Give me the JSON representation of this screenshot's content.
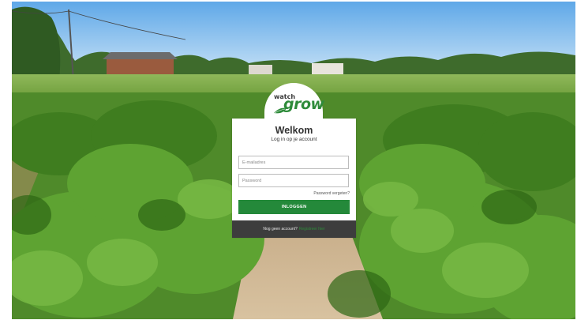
{
  "brand": {
    "logo_text_top": "watch",
    "logo_text_main": "grow",
    "accent": "#24893a"
  },
  "login": {
    "title": "Welkom",
    "subtitle": "Log in op je account",
    "email_placeholder": "E-mailadres",
    "password_placeholder": "Password",
    "forgot_label": "Password vergeten?",
    "submit_label": "INLOGGEN"
  },
  "footer": {
    "prompt": "Nog geen account?",
    "register_label": "Registreer hier"
  }
}
